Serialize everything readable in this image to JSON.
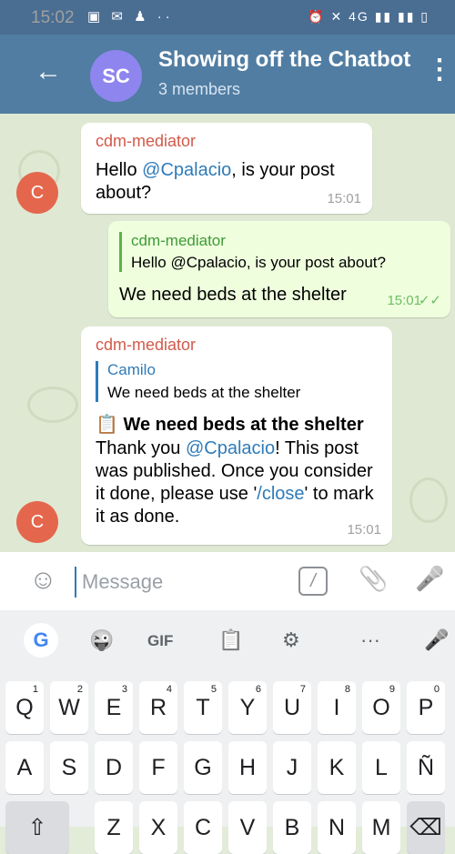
{
  "status_bar": {
    "time": "15:02",
    "left_icons": "▣ ✉ ♟ ··",
    "right_icons": "⏰ ✕ 4G ▮▮ ▮▮ ▯"
  },
  "header": {
    "avatar_initials": "SC",
    "title": "Showing off the Chatbot",
    "subtitle": "3 members",
    "back_icon": "←",
    "menu_icon": "⋮"
  },
  "messages": [
    {
      "sender": "cdm-mediator",
      "text_before": "Hello ",
      "mention": "@Cpalacio",
      "text_after": ", is your post about?",
      "time": "15:01",
      "avatar": "C"
    },
    {
      "quote_sender": "cdm-mediator",
      "quote_text": "Hello @Cpalacio, is your post about?",
      "text": "We need beds at the shelter",
      "time": "15:01",
      "status_icon": "✓✓"
    },
    {
      "sender": "cdm-mediator",
      "quote_sender": "Camilo",
      "quote_text": "We need beds at the shelter",
      "bold_line": "We need beds at the shelter",
      "emoji": "📋",
      "text_part1": "Thank you ",
      "mention": "@Cpalacio",
      "text_part2": "! This post was published. Once you consider it done, please use '",
      "command": "/close",
      "text_part3": "' to mark it as done.",
      "time": "15:01",
      "avatar": "C"
    }
  ],
  "input": {
    "placeholder": "Message",
    "emoji_icon": "☺",
    "command_icon": "/",
    "attach_icon": "📎",
    "mic_icon": "🎤"
  },
  "keyboard_toolbar": {
    "google": "G",
    "sticker": "😜",
    "gif": "GIF",
    "clipboard": "📋",
    "settings": "⚙",
    "more": "···",
    "mic": "🎤"
  },
  "keyboard": {
    "row1": [
      "Q",
      "W",
      "E",
      "R",
      "T",
      "Y",
      "U",
      "I",
      "O",
      "P"
    ],
    "row1_hints": [
      "1",
      "2",
      "3",
      "4",
      "5",
      "6",
      "7",
      "8",
      "9",
      "0"
    ],
    "row2": [
      "A",
      "S",
      "D",
      "F",
      "G",
      "H",
      "J",
      "K",
      "L",
      "Ñ"
    ],
    "row3": [
      "⇧",
      "Z",
      "X",
      "C",
      "V",
      "B",
      "N",
      "M",
      "⌫"
    ]
  },
  "colors": {
    "header": "#517da2",
    "sender": "#d25a4a",
    "mention": "#2f7bb8",
    "outgoing_bubble": "#efffde",
    "avatar": "#e4674d"
  }
}
